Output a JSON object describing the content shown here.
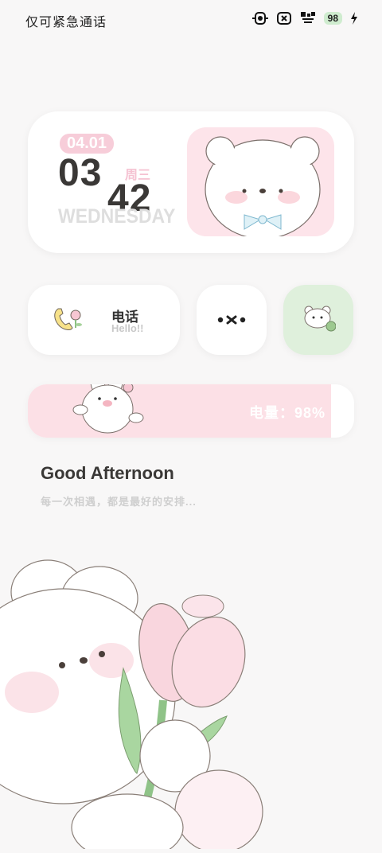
{
  "status_bar": {
    "left_text": "仅可紧急通话",
    "battery": "98",
    "icons": [
      "nfc-icon",
      "sim-x-icon",
      "data-off-icon",
      "battery-badge",
      "charging-bolt-icon"
    ]
  },
  "clock_widget": {
    "date": "04.01",
    "hour": "03",
    "minute": "42",
    "weekday_cn": "周三",
    "weekday_en": "WEDNESDAY"
  },
  "phone_widget": {
    "title": "电话",
    "subtitle": "Hello!!"
  },
  "battery_widget": {
    "label": "电量：98%",
    "level_percent": 93
  },
  "greeting": {
    "title": "Good Afternoon",
    "subtitle": "每一次相遇，都是最好的安排..."
  },
  "colors": {
    "background": "#f8f7f7",
    "pink": "#fde4ea",
    "green": "#dff0dc",
    "dark_text": "#3a3836"
  }
}
